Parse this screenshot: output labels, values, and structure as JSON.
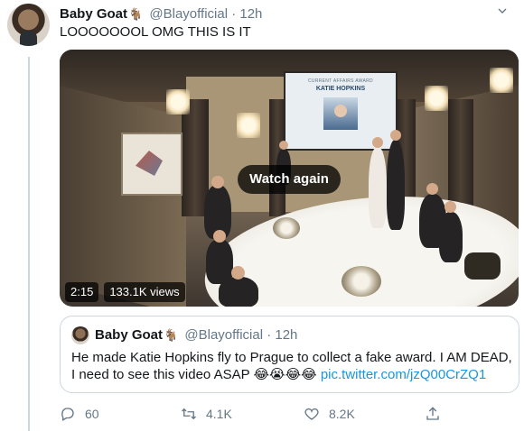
{
  "tweet": {
    "author_name": "Baby Goat",
    "author_emoji": "🐐",
    "handle": "@Blayofficial",
    "separator": "·",
    "time": "12h",
    "text": "LOOOOOOOL OMG THIS IS IT",
    "more_icon": "chevron-down-icon"
  },
  "video": {
    "screen_caption": "CURRENT AFFAIRS AWARD",
    "screen_title": "KATIE HOPKINS",
    "overlay_label": "Watch again",
    "duration": "2:15",
    "views": "133.1K views"
  },
  "quoted": {
    "author_name": "Baby Goat",
    "author_emoji": "🐐",
    "handle": "@Blayofficial",
    "separator": "·",
    "time": "12h",
    "text": "He made Katie Hopkins fly to Prague to collect a fake award. I AM DEAD, I need to see this video ASAP ",
    "emojis": "😂😭😂😂",
    "link": "pic.twitter.com/jzQ00CrZQ1"
  },
  "actions": {
    "reply": {
      "icon": "reply-icon",
      "count": "60"
    },
    "retweet": {
      "icon": "retweet-icon",
      "count": "4.1K"
    },
    "like": {
      "icon": "heart-icon",
      "count": "8.2K"
    },
    "share": {
      "icon": "share-icon"
    }
  },
  "colors": {
    "text_primary": "#14171a",
    "text_muted": "#657786",
    "link": "#1b95e0",
    "border": "#ccd6dd"
  }
}
